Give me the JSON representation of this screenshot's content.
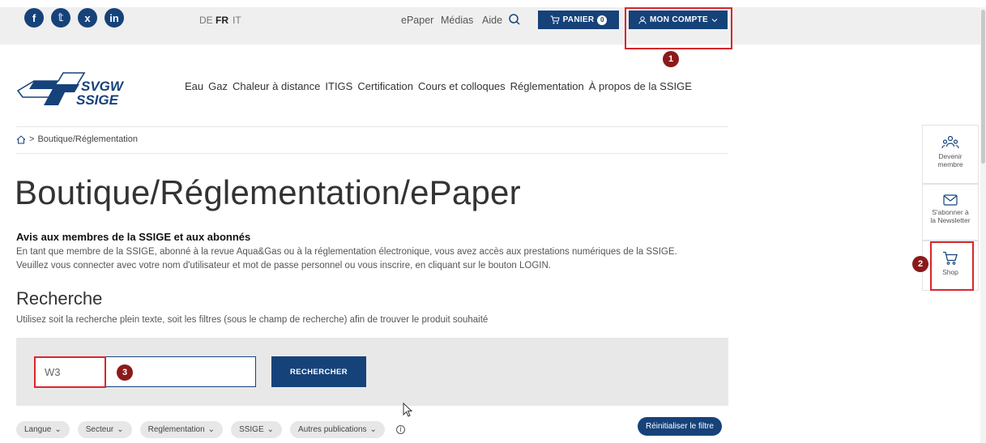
{
  "topbar": {
    "social": [
      "f",
      "𝕥",
      "x",
      "in"
    ],
    "languages": [
      {
        "code": "DE",
        "active": false
      },
      {
        "code": "FR",
        "active": true
      },
      {
        "code": "IT",
        "active": false
      }
    ],
    "links": [
      "ePaper",
      "Médias",
      "Aide"
    ],
    "cart_label": "PANIER",
    "cart_count": "0",
    "account_label": "MON COMPTE"
  },
  "logo": {
    "line1": "SVGW",
    "line2": "SSIGE"
  },
  "nav": [
    "Eau",
    "Gaz",
    "Chaleur à distance",
    "ITIGS",
    "Certification",
    "Cours et colloques",
    "Réglementation",
    "À propos de la SSIGE"
  ],
  "breadcrumb": {
    "current": "Boutique/Réglementation"
  },
  "page_title": "Boutique/Réglementation/ePaper",
  "notice": {
    "title": "Avis aux membres de la SSIGE et aux abonnés",
    "line1": "En tant que membre de la SSIGE, abonné à la revue Aqua&Gas ou à la réglementation électronique, vous avez accès aux prestations numériques de la SSIGE.",
    "line2": "Veuillez vous connecter avec votre nom d'utilisateur et mot de passe personnel ou vous inscrire, en cliquant sur le bouton LOGIN."
  },
  "search": {
    "heading": "Recherche",
    "hint": "Utilisez soit la recherche plein texte, soit les filtres (sous le champ de recherche) afin de trouver le produit souhaité",
    "value": "W3",
    "button": "RECHERCHER"
  },
  "filters": [
    "Langue",
    "Secteur",
    "Reglementation",
    "SSIGE",
    "Autres publications"
  ],
  "reset_label": "Réinitialiser le filtre",
  "side": {
    "member": [
      "Devenir",
      "membre"
    ],
    "newsletter": [
      "S'abonner à",
      "la Newsletter"
    ],
    "shop": "Shop"
  },
  "markers": [
    "1",
    "2",
    "3"
  ],
  "colors": {
    "brand": "#16427a",
    "highlight": "#d9262b",
    "marker": "#8b1a1a"
  }
}
